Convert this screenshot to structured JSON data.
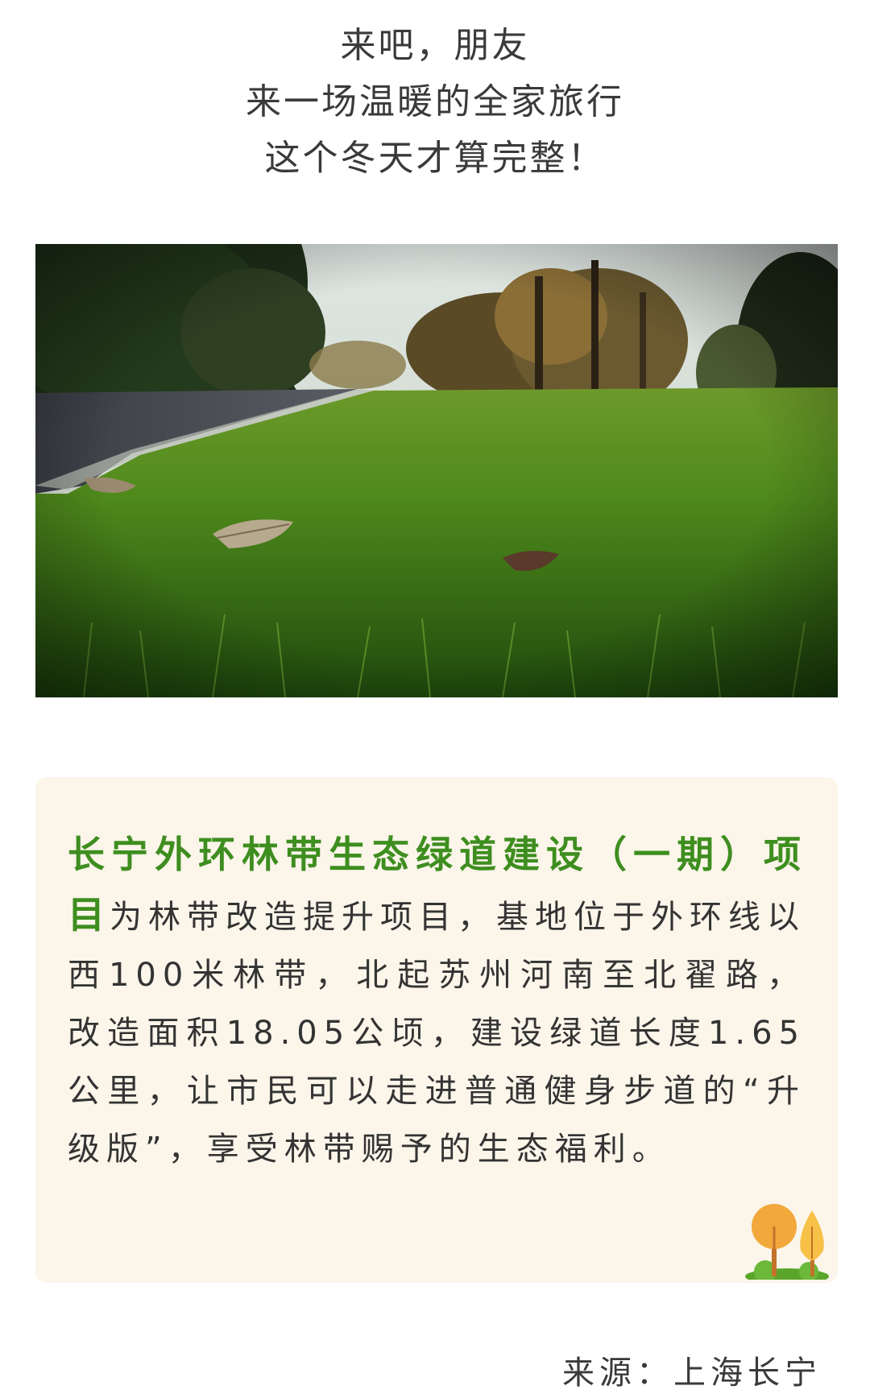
{
  "intro": {
    "line1": "来吧，朋友",
    "line2": "来一场温暖的全家旅行",
    "line3": "这个冬天才算完整！"
  },
  "photo": {
    "icon": "grass-path-photo"
  },
  "card": {
    "highlight": "长宁外环林带生态绿道建设（一期）项目",
    "body": "为林带改造提升项目，基地位于外环线以西100米林带，北起苏州河南至北翟路，改造面积18.05公顷，建设绿道长度1.65公里，让市民可以走进普通健身步道的“升级版”，享受林带赐予的生态福利。",
    "highlight_color": "#3e8e1f",
    "background_color": "#fbf5ea",
    "icon": "trees-icon"
  },
  "source": {
    "text": "来源：上海长宁"
  }
}
